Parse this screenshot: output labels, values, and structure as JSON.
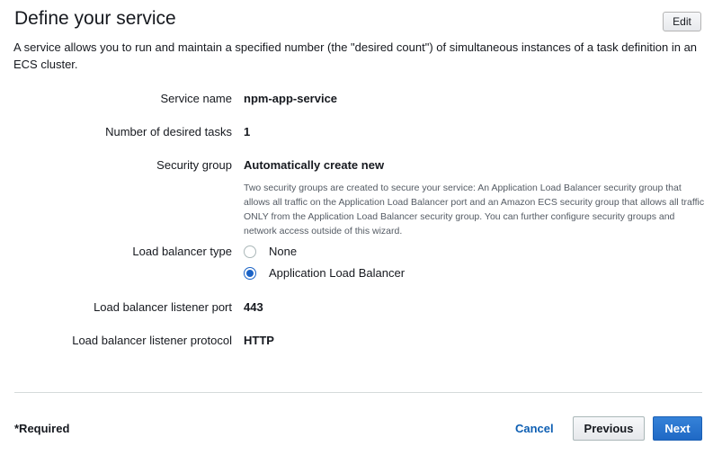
{
  "header": {
    "title": "Define your service",
    "edit_label": "Edit"
  },
  "description": "A service allows you to run and maintain a specified number (the \"desired count\") of simultaneous instances of a task definition in an ECS cluster.",
  "fields": {
    "service_name": {
      "label": "Service name",
      "value": "npm-app-service"
    },
    "desired_tasks": {
      "label": "Number of desired tasks",
      "value": "1"
    },
    "security_group": {
      "label": "Security group",
      "value": "Automatically create new",
      "help": "Two security groups are created to secure your service: An Application Load Balancer security group that allows all traffic on the Application Load Balancer port and an Amazon ECS security group that allows all traffic ONLY from the Application Load Balancer security group. You can further configure security groups and network access outside of this wizard."
    },
    "lb_type": {
      "label": "Load balancer type",
      "options": [
        {
          "label": "None",
          "selected": false
        },
        {
          "label": "Application Load Balancer",
          "selected": true
        }
      ]
    },
    "listener_port": {
      "label": "Load balancer listener port",
      "value": "443"
    },
    "listener_protocol": {
      "label": "Load balancer listener protocol",
      "value": "HTTP"
    }
  },
  "footer": {
    "required": "*Required",
    "cancel_label": "Cancel",
    "previous_label": "Previous",
    "next_label": "Next"
  },
  "colors": {
    "primary": "#1f69c5",
    "link": "#0e5fb3",
    "help_text": "#545b64"
  }
}
